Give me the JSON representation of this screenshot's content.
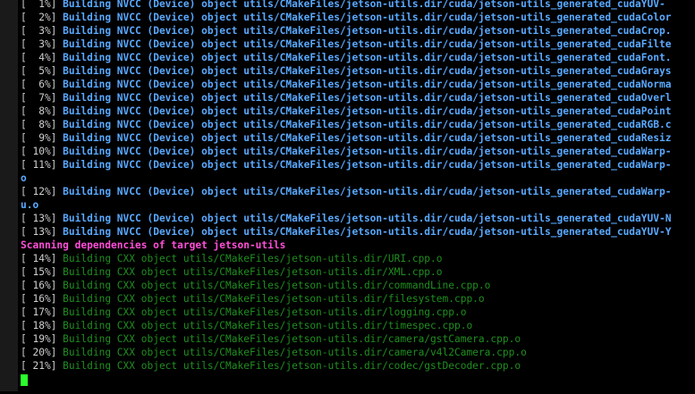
{
  "terminal": {
    "lines": [
      {
        "pct": "[  1%]",
        "text": "Building NVCC (Device) object utils/CMakeFiles/jetson-utils.dir/cuda/jetson-utils_generated_cudaYUV-"
      },
      {
        "pct": "[  2%]",
        "text": "Building NVCC (Device) object utils/CMakeFiles/jetson-utils.dir/cuda/jetson-utils_generated_cudaColor"
      },
      {
        "pct": "[  3%]",
        "text": "Building NVCC (Device) object utils/CMakeFiles/jetson-utils.dir/cuda/jetson-utils_generated_cudaCrop."
      },
      {
        "pct": "[  3%]",
        "text": "Building NVCC (Device) object utils/CMakeFiles/jetson-utils.dir/cuda/jetson-utils_generated_cudaFilte"
      },
      {
        "pct": "[  4%]",
        "text": "Building NVCC (Device) object utils/CMakeFiles/jetson-utils.dir/cuda/jetson-utils_generated_cudaFont."
      },
      {
        "pct": "[  5%]",
        "text": "Building NVCC (Device) object utils/CMakeFiles/jetson-utils.dir/cuda/jetson-utils_generated_cudaGrays"
      },
      {
        "pct": "[  6%]",
        "text": "Building NVCC (Device) object utils/CMakeFiles/jetson-utils.dir/cuda/jetson-utils_generated_cudaNorma"
      },
      {
        "pct": "[  7%]",
        "text": "Building NVCC (Device) object utils/CMakeFiles/jetson-utils.dir/cuda/jetson-utils_generated_cudaOverl"
      },
      {
        "pct": "[  8%]",
        "text": "Building NVCC (Device) object utils/CMakeFiles/jetson-utils.dir/cuda/jetson-utils_generated_cudaPoint"
      },
      {
        "pct": "[  8%]",
        "text": "Building NVCC (Device) object utils/CMakeFiles/jetson-utils.dir/cuda/jetson-utils_generated_cudaRGB.c"
      },
      {
        "pct": "[  9%]",
        "text": "Building NVCC (Device) object utils/CMakeFiles/jetson-utils.dir/cuda/jetson-utils_generated_cudaResiz"
      },
      {
        "pct": "[ 10%]",
        "text": "Building NVCC (Device) object utils/CMakeFiles/jetson-utils.dir/cuda/jetson-utils_generated_cudaWarp-"
      },
      {
        "pct": "[ 11%]",
        "text": "Building NVCC (Device) object utils/CMakeFiles/jetson-utils.dir/cuda/jetson-utils_generated_cudaWarp-"
      },
      {
        "pct": "",
        "text": "o"
      },
      {
        "pct": "[ 12%]",
        "text": "Building NVCC (Device) object utils/CMakeFiles/jetson-utils.dir/cuda/jetson-utils_generated_cudaWarp-"
      },
      {
        "pct": "",
        "text": "u.o"
      },
      {
        "pct": "[ 13%]",
        "text": "Building NVCC (Device) object utils/CMakeFiles/jetson-utils.dir/cuda/jetson-utils_generated_cudaYUV-N"
      },
      {
        "pct": "[ 13%]",
        "text": "Building NVCC (Device) object utils/CMakeFiles/jetson-utils.dir/cuda/jetson-utils_generated_cudaYUV-Y"
      },
      {
        "pct": "",
        "text": "Scanning dependencies of target jetson-utils"
      },
      {
        "pct": "[ 14%]",
        "text": "Building CXX object utils/CMakeFiles/jetson-utils.dir/URI.cpp.o"
      },
      {
        "pct": "[ 15%]",
        "text": "Building CXX object utils/CMakeFiles/jetson-utils.dir/XML.cpp.o"
      },
      {
        "pct": "[ 16%]",
        "text": "Building CXX object utils/CMakeFiles/jetson-utils.dir/commandLine.cpp.o"
      },
      {
        "pct": "[ 16%]",
        "text": "Building CXX object utils/CMakeFiles/jetson-utils.dir/filesystem.cpp.o"
      },
      {
        "pct": "[ 17%]",
        "text": "Building CXX object utils/CMakeFiles/jetson-utils.dir/logging.cpp.o"
      },
      {
        "pct": "[ 18%]",
        "text": "Building CXX object utils/CMakeFiles/jetson-utils.dir/timespec.cpp.o"
      },
      {
        "pct": "[ 19%]",
        "text": "Building CXX object utils/CMakeFiles/jetson-utils.dir/camera/gstCamera.cpp.o"
      },
      {
        "pct": "[ 20%]",
        "text": "Building CXX object utils/CMakeFiles/jetson-utils.dir/camera/v4l2Camera.cpp.o"
      },
      {
        "pct": "[ 21%]",
        "text": "Building CXX object utils/CMakeFiles/jetson-utils.dir/codec/gstDecoder.cpp.o"
      }
    ],
    "colors": {
      "background": "#000000",
      "nvcc": "#5aa9ff",
      "cxx": "#1f8f1f",
      "scan": "#ff4fd8",
      "cursor": "#2bff2b"
    }
  }
}
